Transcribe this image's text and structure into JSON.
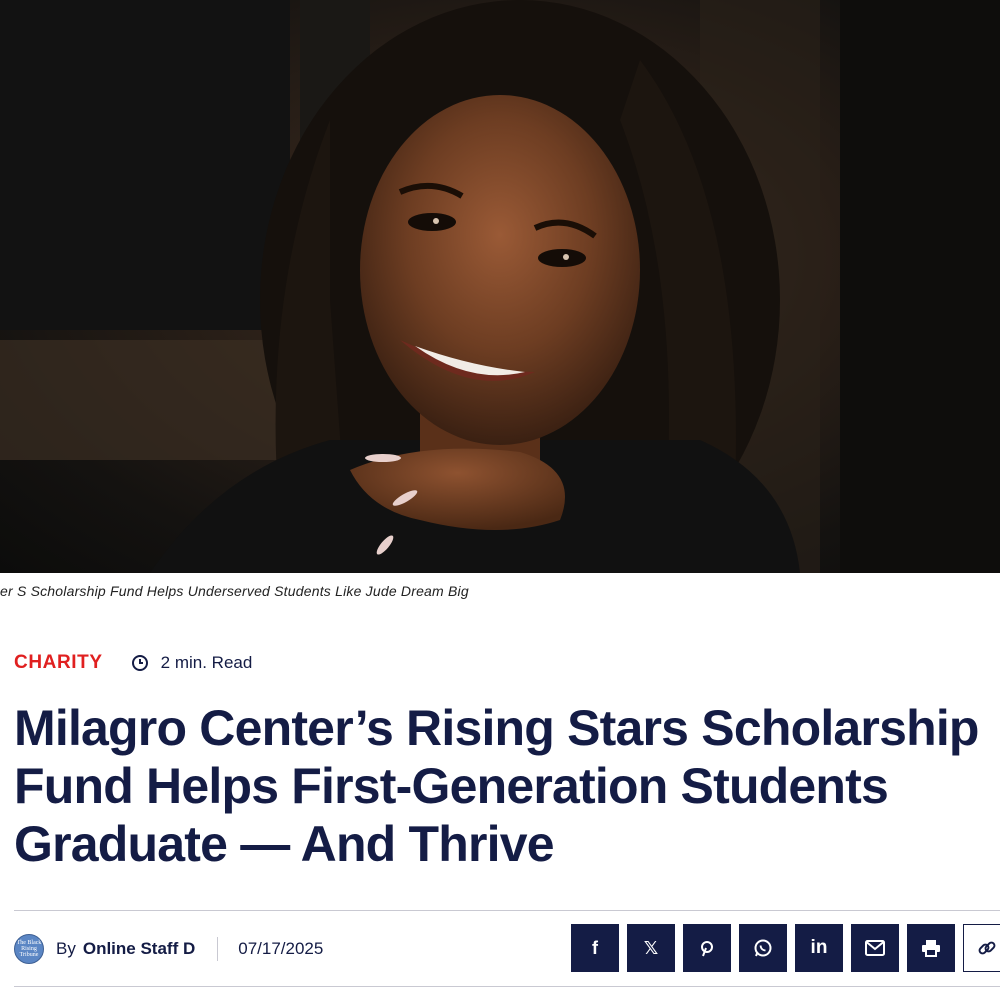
{
  "hero": {
    "caption": "er S Scholarship Fund Helps Underserved Students Like Jude Dream Big"
  },
  "article": {
    "category": "CHARITY",
    "read_time": "2 min. Read",
    "headline": "Milagro Center’s Rising Stars Scholarship Fund Helps First-Generation Students Graduate — And Thrive"
  },
  "byline": {
    "avatar_text": "The Black Rising Tribune",
    "by_label": "By",
    "author": "Online Staff D",
    "date": "07/17/2025"
  },
  "share": {
    "buttons": [
      {
        "label": "f",
        "icon": "facebook-icon"
      },
      {
        "label": "𝕏",
        "icon": "x-icon"
      },
      {
        "label": "",
        "icon": "pinterest-icon"
      },
      {
        "label": "",
        "icon": "whatsapp-icon"
      },
      {
        "label": "in",
        "icon": "linkedin-icon"
      },
      {
        "label": "",
        "icon": "email-icon"
      },
      {
        "label": "",
        "icon": "print-icon"
      },
      {
        "label": "",
        "icon": "link-icon"
      }
    ]
  },
  "colors": {
    "brand_navy": "#141c45",
    "category_red": "#e02020"
  }
}
